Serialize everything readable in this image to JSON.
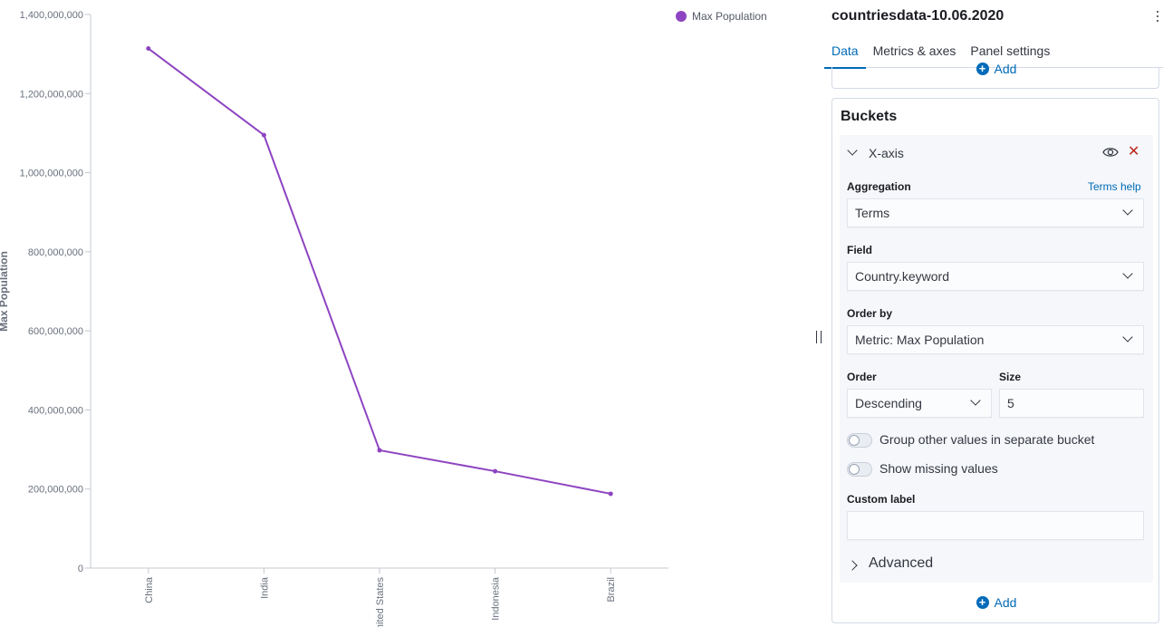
{
  "chart_data": {
    "type": "line",
    "categories": [
      "China",
      "India",
      "United States",
      "Indonesia",
      "Brazil"
    ],
    "series": [
      {
        "name": "Max Population",
        "values": [
          1314000000,
          1095000000,
          298000000,
          245000000,
          188000000
        ],
        "color": "#8e44c1"
      }
    ],
    "ylabel": "Max Population",
    "ylim": [
      0,
      1400000000
    ],
    "yticks": [
      0,
      200000000,
      400000000,
      600000000,
      800000000,
      1000000000,
      1200000000,
      1400000000
    ],
    "ytick_labels": [
      "0",
      "200,000,000",
      "400,000,000",
      "600,000,000",
      "800,000,000",
      "1,000,000,000",
      "1,200,000,000",
      "1,400,000,000"
    ],
    "legend": "top-right",
    "grid": false
  },
  "legend": {
    "label": "Max Population",
    "color": "#8e44c1"
  },
  "panel": {
    "title": "countriesdata-10.06.2020",
    "tabs": [
      {
        "label": "Data",
        "active": true
      },
      {
        "label": "Metrics & axes",
        "active": false
      },
      {
        "label": "Panel settings",
        "active": false
      }
    ],
    "metrics_add_label": "Add",
    "buckets": {
      "title": "Buckets",
      "bucket_name": "X-axis",
      "aggregation_label": "Aggregation",
      "aggregation_help": "Terms help",
      "aggregation_value": "Terms",
      "field_label": "Field",
      "field_value": "Country.keyword",
      "order_by_label": "Order by",
      "order_by_value": "Metric: Max Population",
      "order_label": "Order",
      "order_value": "Descending",
      "size_label": "Size",
      "size_value": "5",
      "group_other_label": "Group other values in separate bucket",
      "show_missing_label": "Show missing values",
      "custom_label_label": "Custom label",
      "custom_label_value": "",
      "advanced_label": "Advanced",
      "add_label": "Add"
    }
  }
}
